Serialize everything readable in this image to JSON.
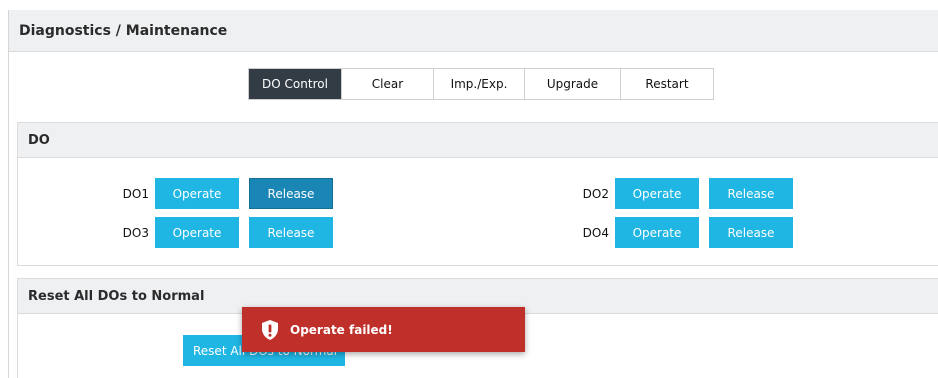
{
  "page_title": "Diagnostics / Maintenance",
  "tabs": [
    {
      "label": "DO Control",
      "active": true
    },
    {
      "label": "Clear",
      "active": false
    },
    {
      "label": "Imp./Exp.",
      "active": false
    },
    {
      "label": "Upgrade",
      "active": false
    },
    {
      "label": "Restart",
      "active": false
    }
  ],
  "do_section": {
    "title": "DO",
    "rows": [
      {
        "label": "DO1",
        "operate": "Operate",
        "release": "Release"
      },
      {
        "label": "DO2",
        "operate": "Operate",
        "release": "Release"
      },
      {
        "label": "DO3",
        "operate": "Operate",
        "release": "Release"
      },
      {
        "label": "DO4",
        "operate": "Operate",
        "release": "Release"
      }
    ]
  },
  "reset_section": {
    "title": "Reset All DOs to Normal",
    "button_label": "Reset All DOs to Normal"
  },
  "toast": {
    "message": "Operate failed!",
    "icon": "shield-alert-icon",
    "color": "#c0302b"
  },
  "colors": {
    "accent": "#1fb6e4",
    "active_tab": "#333b45",
    "pressed": "#1a86b5"
  }
}
